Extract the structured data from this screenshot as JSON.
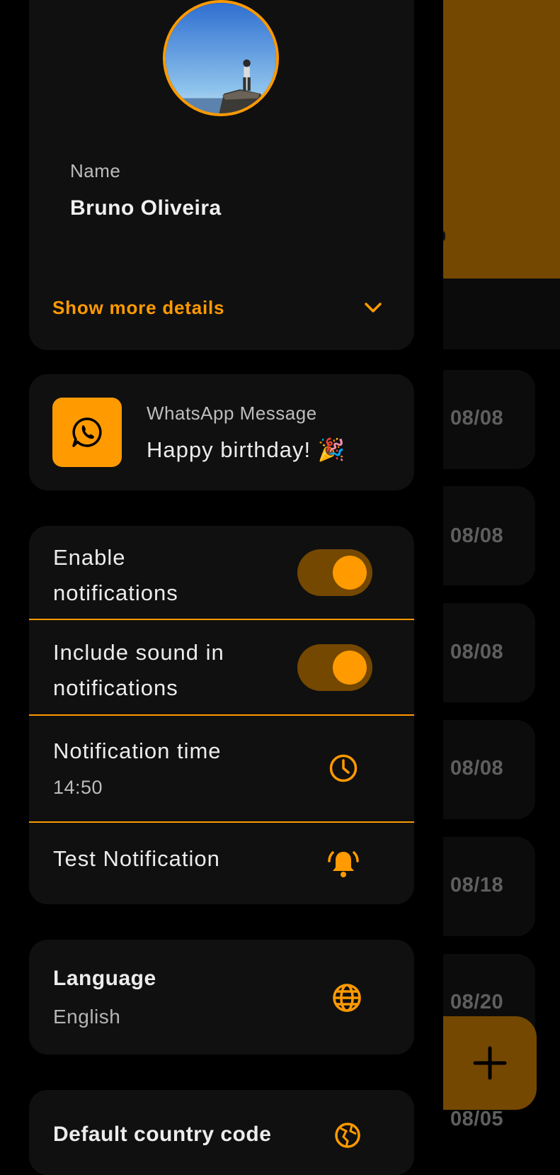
{
  "profile": {
    "name_label": "Name",
    "name_value": "Bruno Oliveira",
    "show_more": "Show more details"
  },
  "message": {
    "title": "WhatsApp Message",
    "text": "Happy birthday! 🎉"
  },
  "settings": {
    "enable_notifications_line1": "Enable",
    "enable_notifications_line2": "notifications",
    "enable_notifications_on": true,
    "include_sound_line1": "Include sound in",
    "include_sound_line2": "notifications",
    "include_sound_on": true,
    "notification_time_label": "Notification time",
    "notification_time_value": "14:50",
    "test_notification_label": "Test Notification"
  },
  "language": {
    "label": "Language",
    "value": "English"
  },
  "country": {
    "label": "Default country code"
  },
  "background_list": {
    "dates": [
      "08/08",
      "08/08",
      "08/08",
      "08/08",
      "08/18",
      "08/20",
      "08/05"
    ]
  },
  "icons": [
    "chevron-down-icon",
    "whatsapp-icon",
    "clock-icon",
    "bell-ring-icon",
    "globe-icon",
    "globe-partial-icon",
    "plus-icon"
  ],
  "colors": {
    "accent": "#ff9a00",
    "accent_dark": "#744800",
    "card": "#101010",
    "background": "#000000"
  }
}
